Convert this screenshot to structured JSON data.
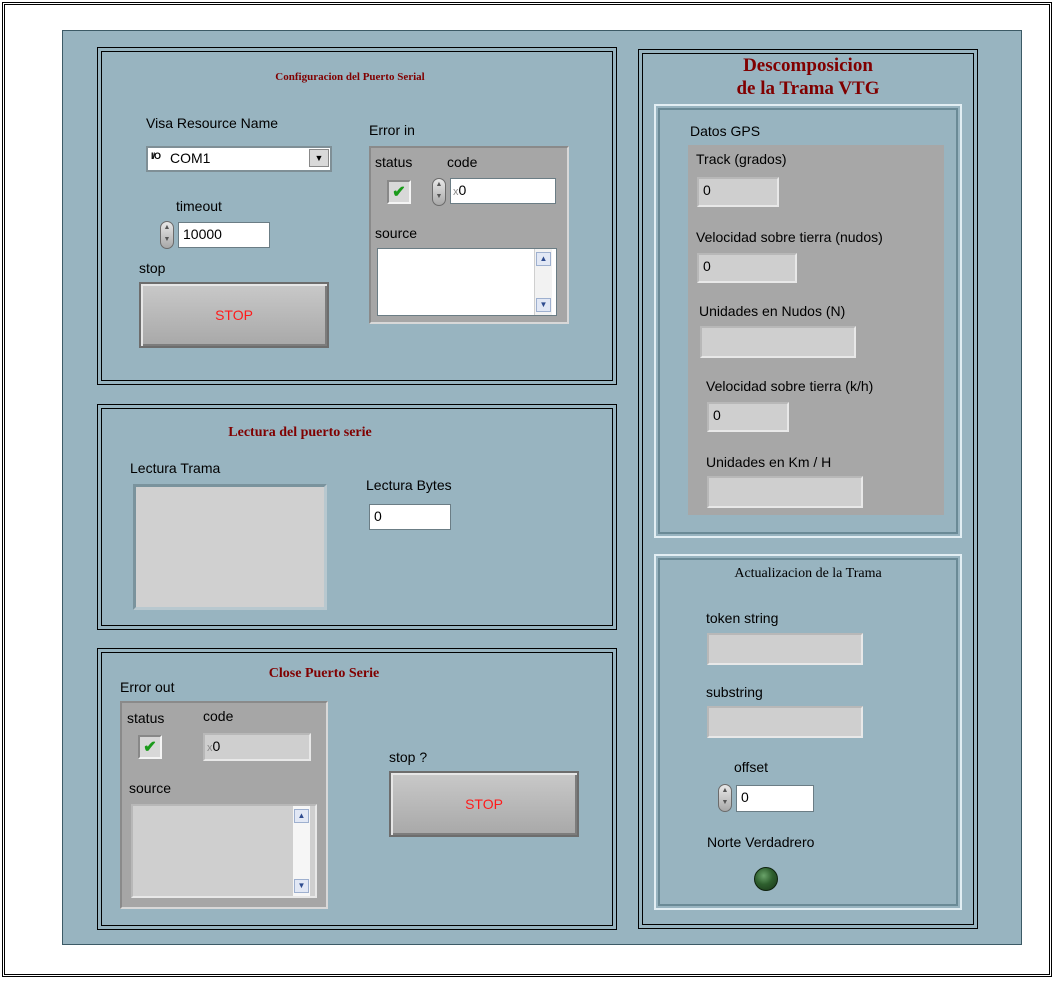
{
  "config": {
    "title": "Configuracion del Puerto Serial",
    "visa_label": "Visa Resource Name",
    "visa_prefix": "I/O",
    "visa_value": "COM1",
    "timeout_label": "timeout",
    "timeout_value": "10000",
    "stop_label": "stop",
    "stop_button": "STOP",
    "error_in": {
      "title": "Error in",
      "status_label": "status",
      "code_label": "code",
      "code_value": "0",
      "code_prefix": "x",
      "source_label": "source",
      "source_value": ""
    }
  },
  "lectura": {
    "title": "Lectura del puerto serie",
    "trama_label": "Lectura Trama",
    "trama_value": "",
    "bytes_label": "Lectura Bytes",
    "bytes_value": "0"
  },
  "close": {
    "title": "Close Puerto Serie",
    "error_out": {
      "title": "Error out",
      "status_label": "status",
      "code_label": "code",
      "code_value": "0",
      "code_prefix": "x",
      "source_label": "source",
      "source_value": ""
    },
    "stop_label": "stop ?",
    "stop_button": "STOP"
  },
  "descomposicion": {
    "title_line1": "Descomposicion",
    "title_line2": "de la Trama VTG",
    "datos_gps": {
      "title": "Datos GPS",
      "track_label": "Track (grados)",
      "track_value": "0",
      "vel_nudos_label": "Velocidad sobre tierra (nudos)",
      "vel_nudos_value": "0",
      "unid_nudos_label": "Unidades en Nudos (N)",
      "unid_nudos_value": "",
      "vel_kmh_label": "Velocidad sobre tierra (k/h)",
      "vel_kmh_value": "0",
      "unid_kmh_label": "Unidades en Km / H",
      "unid_kmh_value": ""
    }
  },
  "actualizacion": {
    "title": "Actualizacion de la Trama",
    "token_label": "token string",
    "token_value": "",
    "substring_label": "substring",
    "substring_value": "",
    "offset_label": "offset",
    "offset_value": "0",
    "norte_label": "Norte Verdadrero"
  }
}
